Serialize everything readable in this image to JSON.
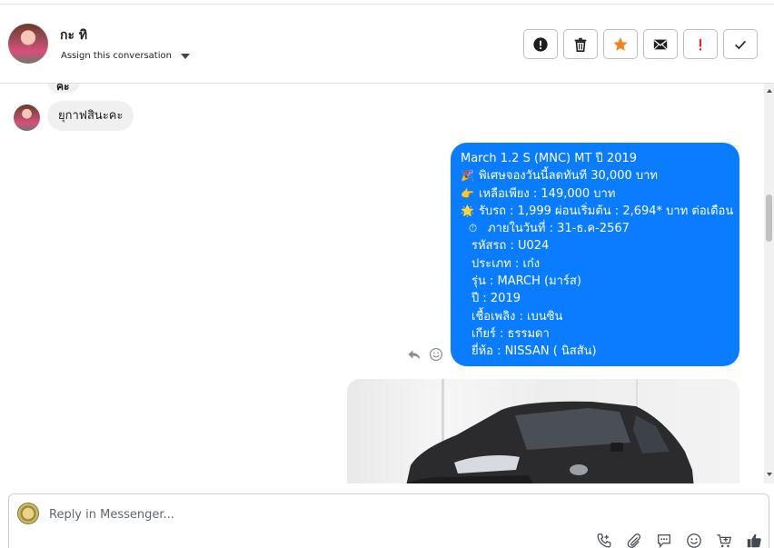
{
  "conversation": {
    "contact_name": "กะ ทิ",
    "assign_label": "Assign this conversation"
  },
  "header_actions": [
    {
      "name": "spam-button",
      "icon": "exclamation-circle-icon"
    },
    {
      "name": "delete-button",
      "icon": "trash-icon"
    },
    {
      "name": "star-button",
      "icon": "star-icon",
      "color": "#f5821f"
    },
    {
      "name": "email-button",
      "icon": "envelope-icon"
    },
    {
      "name": "important-button",
      "icon": "exclamation-icon",
      "color": "#e4282b"
    },
    {
      "name": "done-button",
      "icon": "check-icon"
    }
  ],
  "messages": {
    "prev_fragment": "คะ",
    "incoming_text": "ยุกาฟสินะคะ",
    "outgoing": {
      "lines": [
        {
          "icon": "",
          "text": "March 1.2 S (MNC) MT ปี 2019"
        },
        {
          "icon": "🎉",
          "text": "พิเศษจองวันนี้ลดทันที 30,000 บาท"
        },
        {
          "icon": "👉",
          "text": "เหลือเพียง : 149,000 บาท"
        },
        {
          "icon": "🌟",
          "text": "รับรถ : 1,999 ผ่อนเริ่มต้น : 2,694* บาท ต่อเดือน"
        },
        {
          "icon": "⏱",
          "text": "ภายในวันที่ : 31-ธ.ค-2567"
        },
        {
          "icon": "",
          "text": "รหัสรถ : U024"
        },
        {
          "icon": "",
          "text": "ประเภท : เก๋ง"
        },
        {
          "icon": "",
          "text": "รุ่น : MARCH (มาร์ส)"
        },
        {
          "icon": "",
          "text": "ปี : 2019"
        },
        {
          "icon": "",
          "text": "เชื้อเพลิง : เบนซิน"
        },
        {
          "icon": "",
          "text": "เกียร์ : ธรรมดา"
        },
        {
          "icon": "",
          "text": "ยี่ห้อ : NISSAN ( นิสสัน)"
        }
      ],
      "bubble_color": "#0a7cff"
    }
  },
  "composer": {
    "placeholder": "Reply in Messenger..."
  },
  "colors": {
    "accent": "#0a7cff",
    "star": "#f5821f",
    "important": "#e4282b"
  }
}
